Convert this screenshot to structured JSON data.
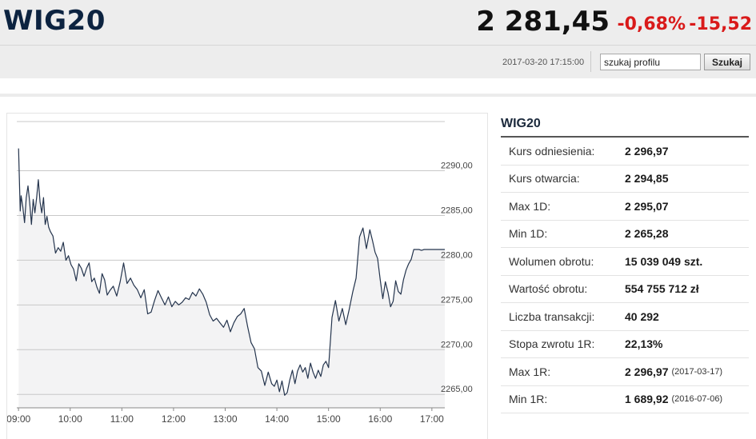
{
  "header": {
    "index_name": "WIG20",
    "value": "2 281,45",
    "change_pct": "-0,68%",
    "change_abs": "-15,52",
    "timestamp": "2017-03-20 17:15:00",
    "search": {
      "value": "szukaj profilu",
      "button_label": "Szukaj"
    }
  },
  "colors": {
    "negative": "#d91a1a",
    "title": "#0c2340",
    "line": "#24344d",
    "area": "#f3f3f4"
  },
  "chart_data": {
    "type": "area",
    "title": "",
    "xlabel": "",
    "ylabel": "",
    "y_axis_side": "right",
    "grid": "horizontal",
    "ylim": [
      2263.5,
      2295.5
    ],
    "xlim": [
      "08:58",
      "17:15"
    ],
    "y_ticks": [
      "2265,00",
      "2270,00",
      "2275,00",
      "2280,00",
      "2285,00",
      "2290,00"
    ],
    "y_tick_values": [
      2265,
      2270,
      2275,
      2280,
      2285,
      2290
    ],
    "x_ticks": [
      "09:00",
      "10:00",
      "11:00",
      "12:00",
      "13:00",
      "14:00",
      "15:00",
      "16:00",
      "17:00"
    ],
    "series": [
      {
        "x": [
          "09:00",
          "09:02",
          "09:03",
          "09:05",
          "09:07",
          "09:09",
          "09:11",
          "09:13",
          "09:15",
          "09:17",
          "09:19",
          "09:21",
          "09:23",
          "09:25",
          "09:27",
          "09:29",
          "09:31",
          "09:33",
          "09:35",
          "09:37",
          "09:40",
          "09:43",
          "09:46",
          "09:49",
          "09:52",
          "09:55",
          "09:58",
          "10:01",
          "10:04",
          "10:07",
          "10:10",
          "10:13",
          "10:16",
          "10:19",
          "10:22",
          "10:25",
          "10:28",
          "10:31",
          "10:34",
          "10:37",
          "10:40",
          "10:43",
          "10:46",
          "10:50",
          "10:54",
          "10:58",
          "11:02",
          "11:06",
          "11:10",
          "11:14",
          "11:18",
          "11:22",
          "11:26",
          "11:30",
          "11:34",
          "11:38",
          "11:42",
          "11:46",
          "11:50",
          "11:54",
          "11:58",
          "12:02",
          "12:06",
          "12:10",
          "12:14",
          "12:18",
          "12:22",
          "12:26",
          "12:30",
          "12:34",
          "12:38",
          "12:42",
          "12:46",
          "12:50",
          "12:54",
          "12:58",
          "13:02",
          "13:06",
          "13:10",
          "13:14",
          "13:18",
          "13:22",
          "13:26",
          "13:30",
          "13:34",
          "13:38",
          "13:42",
          "13:46",
          "13:50",
          "13:54",
          "13:57",
          "14:00",
          "14:03",
          "14:06",
          "14:09",
          "14:12",
          "14:15",
          "14:18",
          "14:21",
          "14:24",
          "14:27",
          "14:30",
          "14:33",
          "14:36",
          "14:39",
          "14:42",
          "14:45",
          "14:48",
          "14:51",
          "14:54",
          "14:57",
          "15:00",
          "15:04",
          "15:08",
          "15:12",
          "15:16",
          "15:20",
          "15:24",
          "15:28",
          "15:32",
          "15:36",
          "15:40",
          "15:44",
          "15:48",
          "15:51",
          "15:54",
          "15:57",
          "16:00",
          "16:03",
          "16:06",
          "16:09",
          "16:12",
          "16:15",
          "16:18",
          "16:21",
          "16:24",
          "16:27",
          "16:30",
          "16:33",
          "16:36",
          "16:39",
          "16:42",
          "16:45",
          "16:48",
          "16:51",
          "16:54",
          "16:57",
          "17:00",
          "17:05",
          "17:10",
          "17:15"
        ],
        "y": [
          2292.5,
          2285.5,
          2287.2,
          2286.0,
          2284.2,
          2287.0,
          2288.3,
          2286.5,
          2284.0,
          2286.8,
          2285.3,
          2287.0,
          2289.0,
          2286.5,
          2285.3,
          2287.0,
          2284.0,
          2284.9,
          2283.7,
          2283.2,
          2282.7,
          2280.8,
          2281.4,
          2281.0,
          2282.0,
          2280.0,
          2280.5,
          2279.5,
          2279.0,
          2277.7,
          2279.6,
          2279.1,
          2278.2,
          2279.1,
          2279.7,
          2277.6,
          2278.0,
          2277.0,
          2276.3,
          2278.5,
          2277.8,
          2276.1,
          2276.6,
          2277.1,
          2276.0,
          2277.6,
          2279.7,
          2277.4,
          2278.0,
          2277.2,
          2276.7,
          2275.8,
          2276.7,
          2274.0,
          2274.2,
          2275.5,
          2276.6,
          2275.8,
          2275.0,
          2275.9,
          2274.8,
          2275.4,
          2275.0,
          2275.3,
          2275.8,
          2275.6,
          2276.4,
          2276.0,
          2276.8,
          2276.2,
          2275.3,
          2273.9,
          2273.2,
          2273.5,
          2273.0,
          2272.5,
          2273.3,
          2272.0,
          2273.0,
          2273.7,
          2274.0,
          2274.6,
          2272.6,
          2270.8,
          2270.1,
          2268.0,
          2267.6,
          2266.0,
          2267.5,
          2266.2,
          2265.9,
          2266.6,
          2265.3,
          2266.5,
          2264.9,
          2265.2,
          2266.6,
          2267.7,
          2266.2,
          2267.6,
          2268.3,
          2267.5,
          2268.0,
          2266.8,
          2268.5,
          2267.5,
          2266.8,
          2267.7,
          2267.0,
          2268.3,
          2268.7,
          2268.0,
          2273.6,
          2275.5,
          2273.2,
          2274.6,
          2272.8,
          2274.5,
          2276.4,
          2278.0,
          2282.6,
          2283.6,
          2281.3,
          2283.4,
          2282.2,
          2280.9,
          2280.2,
          2277.8,
          2275.7,
          2277.6,
          2276.4,
          2274.8,
          2275.4,
          2277.7,
          2276.5,
          2276.2,
          2277.8,
          2278.9,
          2279.6,
          2280.1,
          2281.2,
          2281.2,
          2281.2,
          2281.1,
          2281.2,
          2281.2,
          2281.2,
          2281.2,
          2281.2,
          2281.2,
          2281.2
        ]
      }
    ]
  },
  "stats": {
    "title": "WIG20",
    "rows": [
      {
        "label": "Kurs odniesienia:",
        "value": "2 296,97",
        "date": ""
      },
      {
        "label": "Kurs otwarcia:",
        "value": "2 294,85",
        "date": ""
      },
      {
        "label": "Max 1D:",
        "value": "2 295,07",
        "date": ""
      },
      {
        "label": "Min 1D:",
        "value": "2 265,28",
        "date": ""
      },
      {
        "label": "Wolumen obrotu:",
        "value": "15 039 049 szt.",
        "date": ""
      },
      {
        "label": "Wartość obrotu:",
        "value": "554 755 712 zł",
        "date": ""
      },
      {
        "label": "Liczba transakcji:",
        "value": "40 292",
        "date": ""
      },
      {
        "label": "Stopa zwrotu 1R:",
        "value": "22,13%",
        "date": ""
      },
      {
        "label": "Max 1R:",
        "value": "2 296,97",
        "date": "(2017-03-17)"
      },
      {
        "label": "Min 1R:",
        "value": "1 689,92",
        "date": "(2016-07-06)"
      }
    ]
  }
}
